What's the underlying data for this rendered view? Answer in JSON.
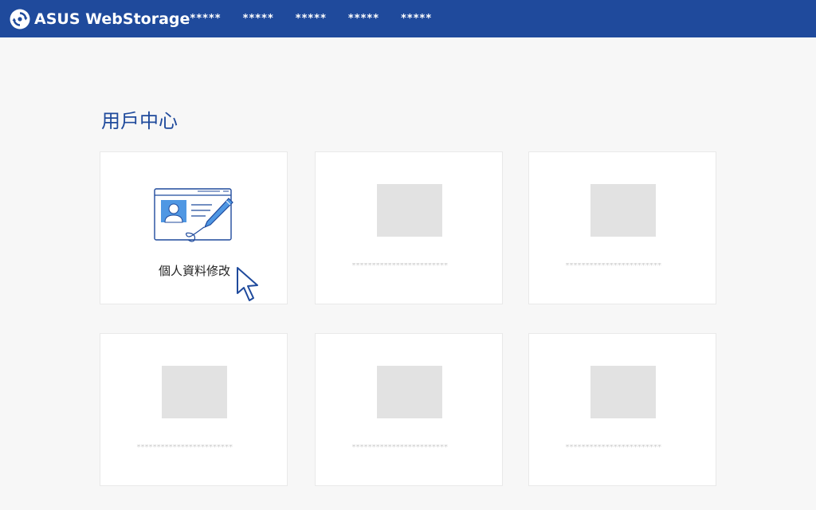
{
  "app": {
    "logo_text": "ASUS WebStorage"
  },
  "nav": {
    "items": [
      "*****",
      "*****",
      "*****",
      "*****",
      "*****"
    ]
  },
  "page": {
    "title": "用戶中心"
  },
  "cards": [
    {
      "label": "個人資料修改",
      "icon": "profile-id-card-edit-icon",
      "active": true
    },
    {
      "label": "************************",
      "placeholder": true
    },
    {
      "label": "************************",
      "placeholder": true
    },
    {
      "label": "************************",
      "placeholder": true
    },
    {
      "label": "************************",
      "placeholder": true
    },
    {
      "label": "************************",
      "placeholder": true
    }
  ],
  "colors": {
    "header_bg": "#1f4a9c",
    "page_bg": "#f7f7f7",
    "title": "#1f4a9c",
    "placeholder": "#e2e2e2",
    "accent_blue": "#4f97e3"
  }
}
